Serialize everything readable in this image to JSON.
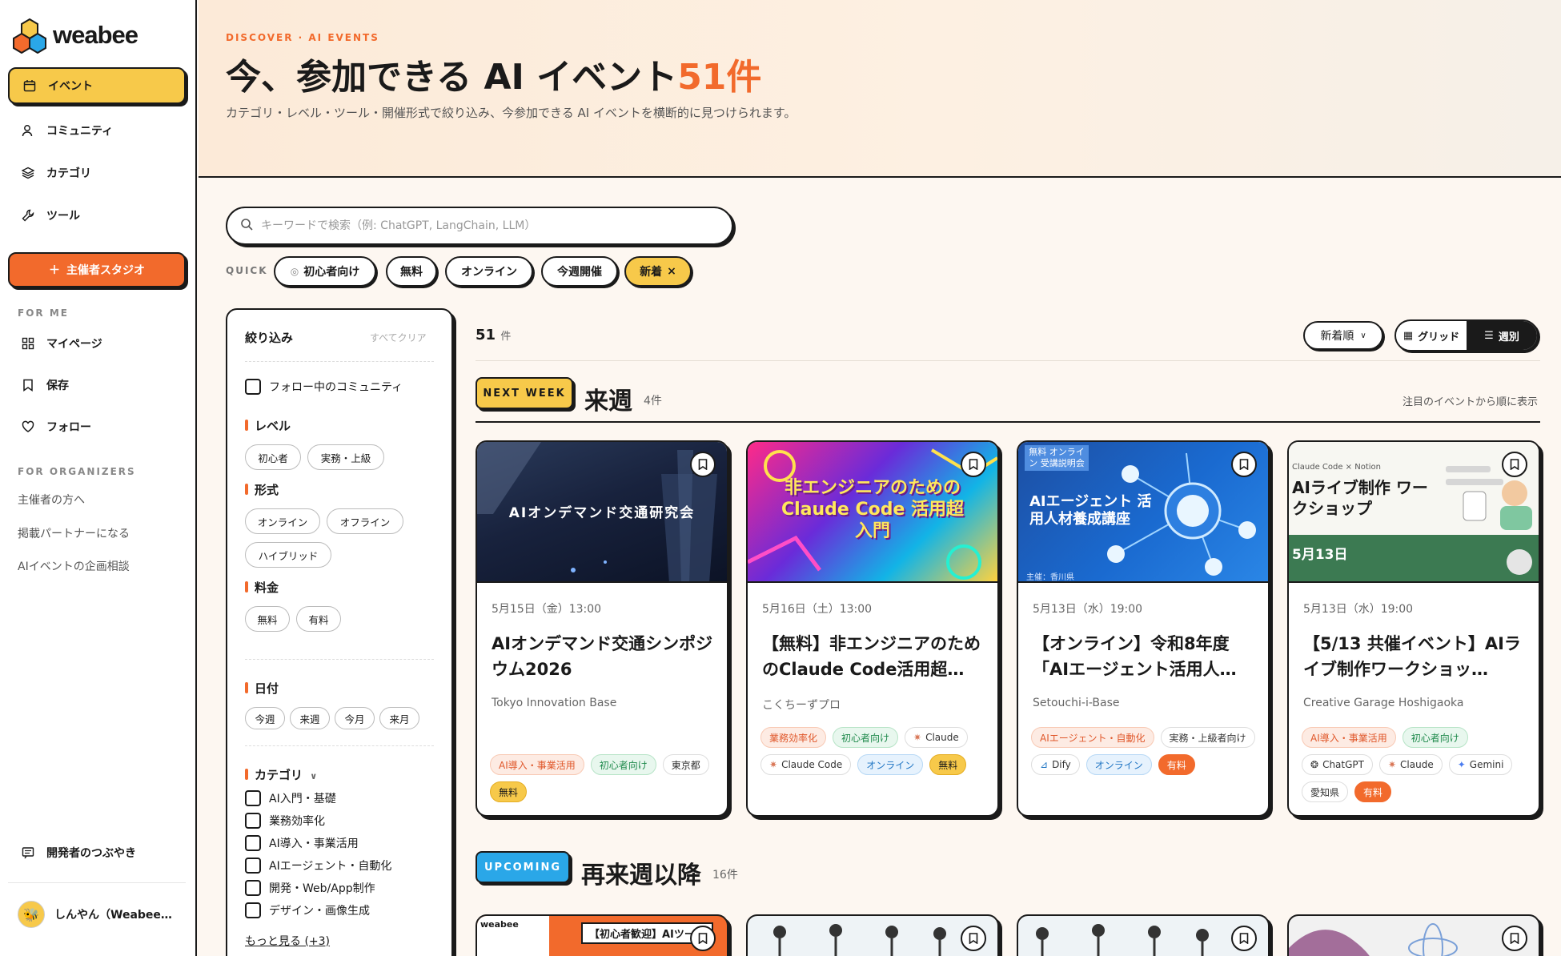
{
  "app": {
    "brand": "weabee"
  },
  "sidebar": {
    "nav": [
      {
        "label": "イベント",
        "icon": "calendar-icon"
      },
      {
        "label": "コミュニティ",
        "icon": "user-icon"
      },
      {
        "label": "カテゴリ",
        "icon": "layers-icon"
      },
      {
        "label": "ツール",
        "icon": "wrench-icon"
      }
    ],
    "studio_button": "主催者スタジオ",
    "for_me_heading": "FOR ME",
    "for_me": [
      {
        "label": "マイページ",
        "icon": "grid-icon"
      },
      {
        "label": "保存",
        "icon": "bookmark-icon"
      },
      {
        "label": "フォロー",
        "icon": "heart-icon"
      }
    ],
    "for_organizers_heading": "FOR ORGANIZERS",
    "for_organizers": [
      "主催者の方へ",
      "掲載パートナーになる",
      "AIイベントの企画相談"
    ],
    "dev_murmur": "開発者のつぶやき",
    "user_name": "しんやん（Weabee…"
  },
  "hero": {
    "eyebrow": "DISCOVER · AI EVENTS",
    "title": "今、参加できる AI イベント",
    "title_count": "51件",
    "subtitle": "カテゴリ・レベル・ツール・開催形式で絞り込み、今参加できる AI イベントを横断的に見つけられます。"
  },
  "search": {
    "placeholder": "キーワードで検索（例: ChatGPT, LangChain, LLM）"
  },
  "quick": {
    "label": "QUICK",
    "chips": [
      "初心者向け",
      "無料",
      "オンライン",
      "今週開催",
      "新着"
    ],
    "active": "新着",
    "close_glyph": "×"
  },
  "filter": {
    "title": "絞り込み",
    "clear_all": "すべてクリア",
    "follow_community": "フォロー中のコミュニティ",
    "level": {
      "label": "レベル",
      "options": [
        "初心者",
        "実務・上級"
      ]
    },
    "format": {
      "label": "形式",
      "options": [
        "オンライン",
        "オフライン",
        "ハイブリッド"
      ]
    },
    "fee": {
      "label": "料金",
      "options": [
        "無料",
        "有料"
      ]
    },
    "date": {
      "label": "日付",
      "options": [
        "今週",
        "来週",
        "今月",
        "来月"
      ]
    },
    "category": {
      "label": "カテゴリ",
      "options": [
        "AI入門・基礎",
        "業務効率化",
        "AI導入・事業活用",
        "AIエージェント・自動化",
        "開発・Web/App制作",
        "デザイン・画像生成"
      ],
      "more": "もっと見る (+3)"
    }
  },
  "results": {
    "count": "51",
    "count_unit": "件",
    "sort": "新着順",
    "view_grid": "グリッド",
    "view_weekly": "週別"
  },
  "sections": [
    {
      "badge": "NEXT WEEK",
      "title": "来週",
      "count": "4件",
      "note": "注目のイベントから順に表示"
    },
    {
      "badge": "UPCOMING",
      "title": "再来週以降",
      "count": "16件"
    }
  ],
  "events": [
    {
      "thumb_text": "AIオンデマンド交通研究会",
      "date": "5月15日（金）13:00",
      "title": "AIオンデマンド交通シンポジウム2026",
      "organizer": "Tokyo Innovation Base",
      "tags": [
        {
          "label": "AI導入・事業活用",
          "style": "orange"
        },
        {
          "label": "初心者向け",
          "style": "green"
        },
        {
          "label": "東京都",
          "style": "gray"
        },
        {
          "label": "無料",
          "style": "yellow"
        }
      ]
    },
    {
      "thumb_text": "非エンジニアのための Claude Code 活用超入門",
      "date": "5月16日（土）13:00",
      "title": "【無料】非エンジニアのためのClaude Code活用超…",
      "organizer": "こくちーずプロ",
      "tags": [
        {
          "label": "業務効率化",
          "style": "orange"
        },
        {
          "label": "初心者向け",
          "style": "green"
        },
        {
          "label": "Claude",
          "style": "gray",
          "icon": "✷"
        },
        {
          "label": "Claude Code",
          "style": "gray",
          "icon": "✷"
        },
        {
          "label": "オンライン",
          "style": "blue"
        },
        {
          "label": "無料",
          "style": "yellow"
        }
      ]
    },
    {
      "thumb_text": "AIエージェント 活用人材養成講座",
      "thumb_badge": "無料 オンライン 受講説明会",
      "thumb_footer": "主催：香川県",
      "date": "5月13日（水）19:00",
      "title": "【オンライン】令和8年度「AIエージェント活用人…",
      "organizer": "Setouchi-i-Base",
      "tags": [
        {
          "label": "AIエージェント・自動化",
          "style": "orange"
        },
        {
          "label": "実務・上級者向け",
          "style": "gray"
        },
        {
          "label": "Dify",
          "style": "gray",
          "icon": "⊿"
        },
        {
          "label": "オンライン",
          "style": "blue"
        },
        {
          "label": "有料",
          "style": "red"
        }
      ]
    },
    {
      "thumb_text": "AIライブ制作 ワークショップ",
      "thumb_badge": "Claude Code × Notion",
      "thumb_footer": "5月13日",
      "date": "5月13日（水）19:00",
      "title": "【5/13 共催イベント】AIライブ制作ワークショッ…",
      "organizer": "Creative Garage Hoshigaoka",
      "tags": [
        {
          "label": "AI導入・事業活用",
          "style": "orange"
        },
        {
          "label": "初心者向け",
          "style": "green"
        },
        {
          "label": "ChatGPT",
          "style": "gray",
          "icon": "❂"
        },
        {
          "label": "Claude",
          "style": "gray",
          "icon": "✷"
        },
        {
          "label": "Gemini",
          "style": "gray",
          "icon": "✦"
        },
        {
          "label": "愛知県",
          "style": "gray"
        },
        {
          "label": "有料",
          "style": "red"
        }
      ]
    }
  ],
  "upcoming_thumbs": [
    "【初心者歓迎】AIツール",
    "",
    "",
    ""
  ],
  "colors": {
    "accent": "#f26a2c",
    "yellow": "#f7c94a",
    "ink": "#1a1a1a",
    "blue": "#2aa7e8"
  }
}
